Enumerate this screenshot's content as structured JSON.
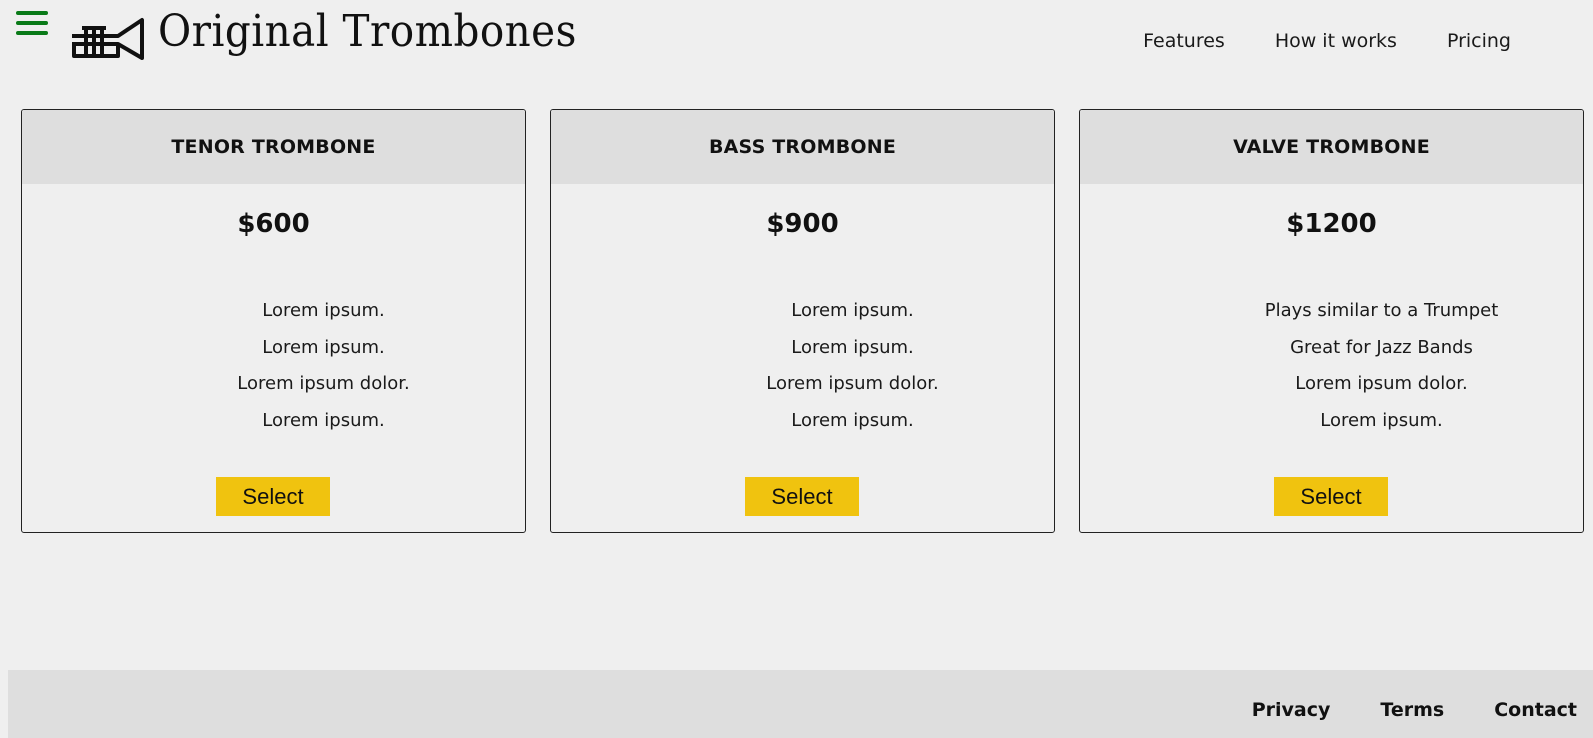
{
  "header": {
    "brand": "Original Trombones",
    "menu_icon": "hamburger-menu-icon",
    "logo_icon": "trumpet-logo-icon",
    "menu_color": "#0a7a18",
    "nav": [
      {
        "label": "Features"
      },
      {
        "label": "How it works"
      },
      {
        "label": "Pricing"
      }
    ]
  },
  "pricing": {
    "button_color": "#f0c30f",
    "cards": [
      {
        "title": "TENOR TROMBONE",
        "price": "$600",
        "features": [
          "Lorem ipsum.",
          "Lorem ipsum.",
          "Lorem ipsum dolor.",
          "Lorem ipsum."
        ],
        "button": "Select"
      },
      {
        "title": "BASS TROMBONE",
        "price": "$900",
        "features": [
          "Lorem ipsum.",
          "Lorem ipsum.",
          "Lorem ipsum dolor.",
          "Lorem ipsum."
        ],
        "button": "Select"
      },
      {
        "title": "VALVE TROMBONE",
        "price": "$1200",
        "features": [
          "Plays similar to a Trumpet",
          "Great for Jazz Bands",
          "Lorem ipsum dolor.",
          "Lorem ipsum."
        ],
        "button": "Select"
      }
    ]
  },
  "footer": {
    "links": [
      {
        "label": "Privacy"
      },
      {
        "label": "Terms"
      },
      {
        "label": "Contact"
      }
    ]
  }
}
